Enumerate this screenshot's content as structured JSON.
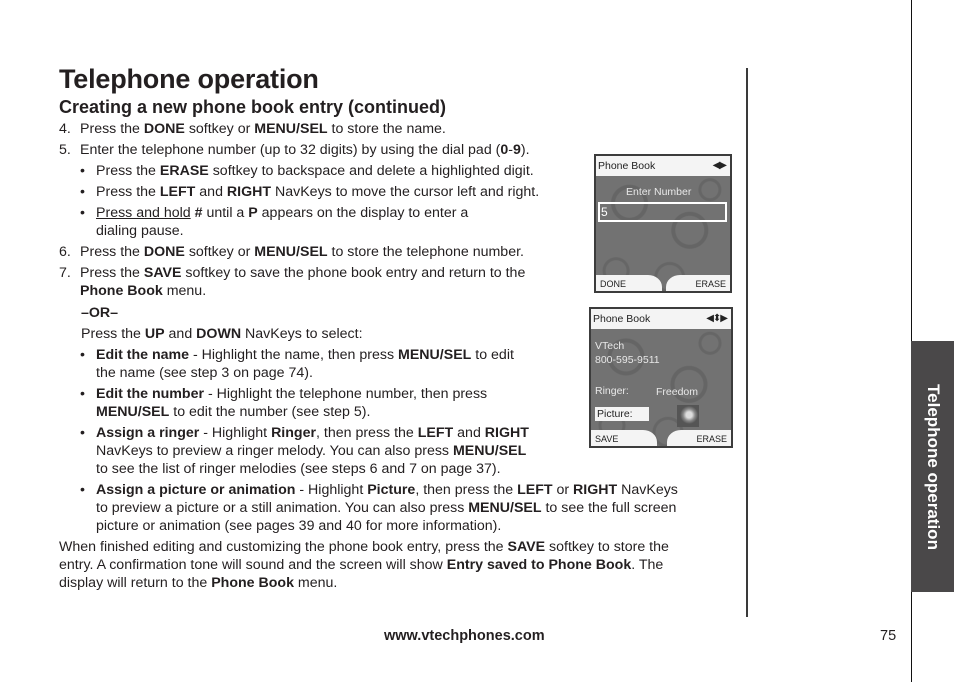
{
  "header": {
    "title": "Telephone operation",
    "section": "Creating a new phone book entry (continued)"
  },
  "steps": {
    "s4": {
      "num": "4.",
      "t1": "Press the ",
      "b1": "DONE",
      "t2": " softkey or ",
      "b2": "MENU/SEL",
      "t3": " to store the name."
    },
    "s5": {
      "num": "5.",
      "t1": "Enter the telephone number (up to 32 digits) by using the dial pad (",
      "b1": "0",
      "t2": "-",
      "b2": "9",
      "t3": ")."
    },
    "s5_bullets": [
      {
        "t1": "Press the ",
        "b1": "ERASE",
        "t2": " softkey to backspace and delete a highlighted digit."
      },
      {
        "t1": "Press the ",
        "b1": "LEFT",
        "t2": " and ",
        "b2": "RIGHT",
        "t3": " NavKeys to move the cursor left and right."
      },
      {
        "u1": "Press and hold",
        "t1": " ",
        "b1": "#",
        "t2": " until a ",
        "b2": "P",
        "t3": " appears on the display to enter a",
        "t4": "dialing pause."
      }
    ],
    "s6": {
      "num": "6.",
      "t1": "Press the ",
      "b1": "DONE",
      "t2": " softkey or ",
      "b2": "MENU/SEL",
      "t3": " to store the telephone number."
    },
    "s7": {
      "num": "7.",
      "t1": "Press the ",
      "b1": "SAVE",
      "t2": " softkey to save the phone book entry and return to the",
      "b2": "Phone Book",
      "t3": " menu."
    },
    "or": "–OR–",
    "updown": {
      "t1": "Press the ",
      "b1": "UP",
      "t2": " and ",
      "b2": "DOWN",
      "t3": " NavKeys to select:"
    },
    "options": [
      {
        "b1": "Edit the name",
        "t1": " - Highlight the name, then press ",
        "b2": "MENU/SEL",
        "t2": " to edit",
        "t3": "the name (see step 3 on page 74)."
      },
      {
        "b1": "Edit the number",
        "t1": " - Highlight the telephone number, then press",
        "b2": "MENU/SEL",
        "t2": " to edit the number (see step 5)."
      },
      {
        "b1": "Assign a ringer",
        "t1": " - Highlight ",
        "b2": "Ringer",
        "t2": ", then press the ",
        "b3": "LEFT",
        "t3": " and ",
        "b4": "RIGHT",
        "t4": "NavKeys to preview a ringer melody. You can also press ",
        "b5": "MENU/SEL",
        "t5": "to see the list of ringer melodies (see steps 6 and 7 on page 37)."
      },
      {
        "b1": "Assign a picture or animation",
        "t1": " - Highlight ",
        "b2": "Picture",
        "t2": ", then press the ",
        "b3": "LEFT",
        "t3": " or ",
        "b4": "RIGHT",
        "t4": " NavKeys",
        "t5": "to preview a picture or a still animation. You can also press ",
        "b5": "MENU/SEL",
        "t6": " to see the full screen",
        "t7": "picture or animation (see pages 39 and 40 for more information)."
      }
    ],
    "closing": {
      "t1": "When finished editing and customizing the phone book entry, press the ",
      "b1": "SAVE",
      "t2": " softkey to store the",
      "t3": "entry. A confirmation tone will sound and the screen will show ",
      "b2": "Entry saved to Phone Book",
      "t4": ". The",
      "t5": "display will return to the ",
      "b3": "Phone Book",
      "t6": " menu."
    }
  },
  "screen1": {
    "header": "Phone Book",
    "nav_icon": "left-right-arrows",
    "prompt": "Enter Number",
    "field_value": "5",
    "softkey_left": "DONE",
    "softkey_right": "ERASE"
  },
  "screen2": {
    "header": "Phone Book",
    "nav_icon": "four-way-arrows",
    "name": "VTech",
    "number": "800-595-9511",
    "ringer_label": "Ringer:",
    "ringer_value": "Freedom",
    "picture_label": "Picture:",
    "softkey_left": "SAVE",
    "softkey_right": "ERASE"
  },
  "side_tab": "Telephone operation",
  "footer": {
    "url": "www.vtechphones.com",
    "page": "75"
  }
}
